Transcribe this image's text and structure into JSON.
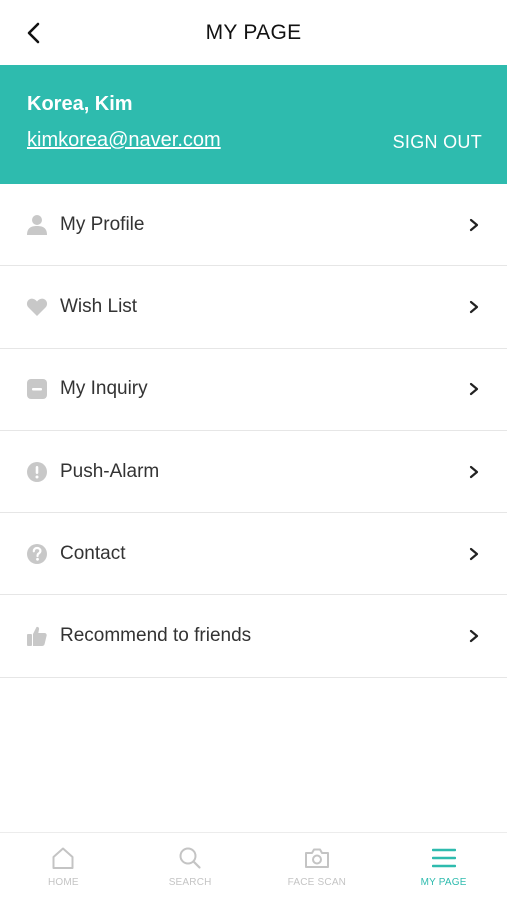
{
  "header": {
    "title": "MY PAGE",
    "back_icon": "chevron-left-icon"
  },
  "account": {
    "name": "Korea, Kim",
    "email": "kimkorea@naver.com",
    "sign_out_label": "SIGN OUT",
    "banner_color": "#2ebbae"
  },
  "menu": {
    "items": [
      {
        "label": "My Profile",
        "icon": "person-icon"
      },
      {
        "label": "Wish List",
        "icon": "heart-icon"
      },
      {
        "label": "My Inquiry",
        "icon": "inquiry-icon"
      },
      {
        "label": "Push-Alarm",
        "icon": "alert-icon"
      },
      {
        "label": "Contact",
        "icon": "question-icon"
      },
      {
        "label": "Recommend to friends",
        "icon": "thumbs-up-icon"
      }
    ]
  },
  "tabbar": {
    "tabs": [
      {
        "label": "HOME",
        "icon": "home-icon",
        "active": false
      },
      {
        "label": "SEARCH",
        "icon": "search-icon",
        "active": false
      },
      {
        "label": "FACE SCAN",
        "icon": "camera-icon",
        "active": false
      },
      {
        "label": "MY PAGE",
        "icon": "menu-icon",
        "active": true
      }
    ],
    "active_color": "#2ebbae",
    "inactive_color": "#c4c4c4"
  }
}
